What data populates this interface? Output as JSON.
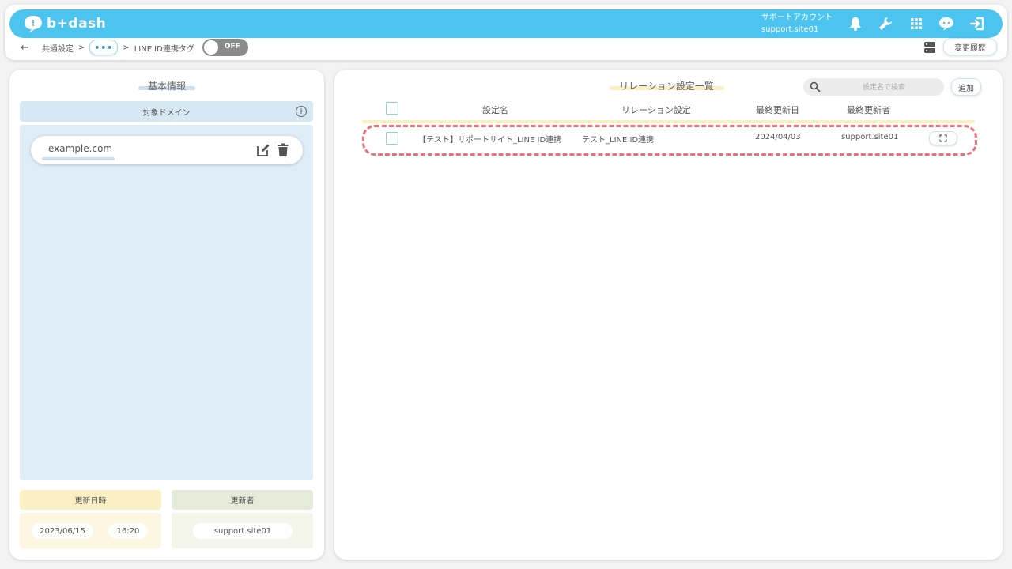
{
  "app": {
    "logo_text": "b+dash"
  },
  "account": {
    "label": "サポートアカウント",
    "id": "support.site01"
  },
  "breadcrumb": {
    "back": "←",
    "root": "共通設定",
    "sep1": ">",
    "more": "•••",
    "sep2": ">",
    "current": "LINE ID連携タグ",
    "toggle_label": "OFF"
  },
  "toolbar": {
    "history_label": "変更履歴"
  },
  "left": {
    "title": "基本情報",
    "domain_header": "対象ドメイン",
    "add_symbol": "+",
    "domains": [
      "example.com"
    ],
    "updated_at_label": "更新日時",
    "updated_by_label": "更新者",
    "updated_date": "2023/06/15",
    "updated_time": "16:20",
    "updated_by": "support.site01"
  },
  "right": {
    "title": "リレーション設定一覧",
    "search_placeholder": "設定名で検索",
    "add_label": "追加",
    "columns": [
      "設定名",
      "リレーション設定",
      "最終更新日",
      "最終更新者"
    ],
    "rows": [
      {
        "name": "【テスト】サポートサイト_LINE ID連携",
        "relation": "テスト_LINE ID連携",
        "updated": "2024/04/03",
        "updated_by": "support.site01"
      }
    ]
  },
  "colors": {
    "brand": "#4dc4f0",
    "highlight_outline": "#ee6f78",
    "left_title_underline": "#cddff0",
    "right_title_underline": "#fbefc4"
  }
}
